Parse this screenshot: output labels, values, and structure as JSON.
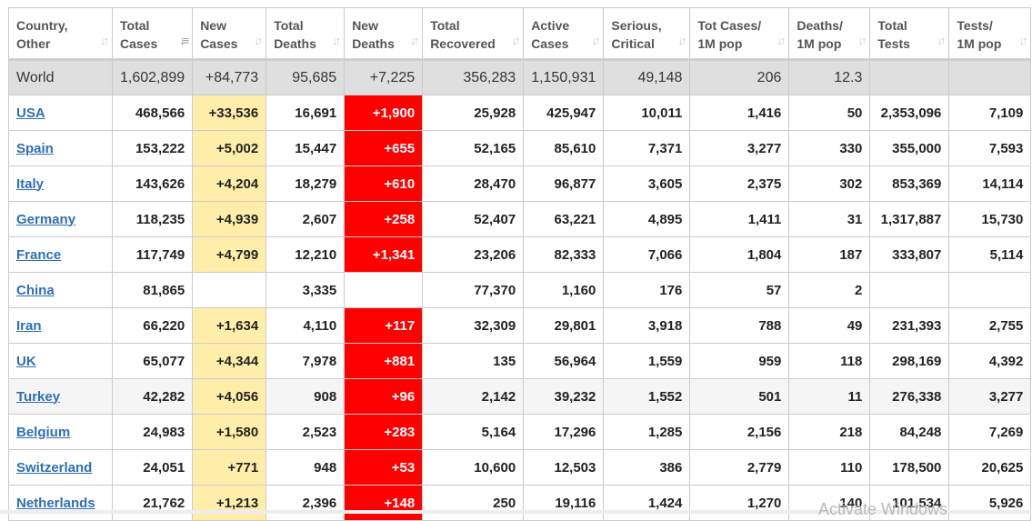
{
  "table": {
    "columns": [
      {
        "line1": "Country,",
        "line2": "Other",
        "sort_icon": "sort-icon",
        "active": false
      },
      {
        "line1": "Total",
        "line2": "Cases",
        "sort_icon": "sort-desc-icon",
        "active": true
      },
      {
        "line1": "New",
        "line2": "Cases",
        "sort_icon": "sort-icon",
        "active": false
      },
      {
        "line1": "Total",
        "line2": "Deaths",
        "sort_icon": "sort-icon",
        "active": false
      },
      {
        "line1": "New",
        "line2": "Deaths",
        "sort_icon": "sort-icon",
        "active": false
      },
      {
        "line1": "Total",
        "line2": "Recovered",
        "sort_icon": "sort-icon",
        "active": false
      },
      {
        "line1": "Active",
        "line2": "Cases",
        "sort_icon": "sort-icon",
        "active": false
      },
      {
        "line1": "Serious,",
        "line2": "Critical",
        "sort_icon": "sort-icon",
        "active": false
      },
      {
        "line1": "Tot Cases/",
        "line2": "1M pop",
        "sort_icon": "sort-icon",
        "active": false
      },
      {
        "line1": "Deaths/",
        "line2": "1M pop",
        "sort_icon": "sort-icon",
        "active": false
      },
      {
        "line1": "Total",
        "line2": "Tests",
        "sort_icon": "sort-icon",
        "active": false
      },
      {
        "line1": "Tests/",
        "line2": "1M pop",
        "sort_icon": "sort-icon",
        "active": false
      }
    ],
    "world": [
      "World",
      "1,602,899",
      "+84,773",
      "95,685",
      "+7,225",
      "356,283",
      "1,150,931",
      "49,148",
      "206",
      "12.3",
      "",
      ""
    ],
    "rows": [
      [
        "USA",
        "468,566",
        "+33,536",
        "16,691",
        "+1,900",
        "25,928",
        "425,947",
        "10,011",
        "1,416",
        "50",
        "2,353,096",
        "7,109"
      ],
      [
        "Spain",
        "153,222",
        "+5,002",
        "15,447",
        "+655",
        "52,165",
        "85,610",
        "7,371",
        "3,277",
        "330",
        "355,000",
        "7,593"
      ],
      [
        "Italy",
        "143,626",
        "+4,204",
        "18,279",
        "+610",
        "28,470",
        "96,877",
        "3,605",
        "2,375",
        "302",
        "853,369",
        "14,114"
      ],
      [
        "Germany",
        "118,235",
        "+4,939",
        "2,607",
        "+258",
        "52,407",
        "63,221",
        "4,895",
        "1,411",
        "31",
        "1,317,887",
        "15,730"
      ],
      [
        "France",
        "117,749",
        "+4,799",
        "12,210",
        "+1,341",
        "23,206",
        "82,333",
        "7,066",
        "1,804",
        "187",
        "333,807",
        "5,114"
      ],
      [
        "China",
        "81,865",
        "",
        "3,335",
        "",
        "77,370",
        "1,160",
        "176",
        "57",
        "2",
        "",
        ""
      ],
      [
        "Iran",
        "66,220",
        "+1,634",
        "4,110",
        "+117",
        "32,309",
        "29,801",
        "3,918",
        "788",
        "49",
        "231,393",
        "2,755"
      ],
      [
        "UK",
        "65,077",
        "+4,344",
        "7,978",
        "+881",
        "135",
        "56,964",
        "1,559",
        "959",
        "118",
        "298,169",
        "4,392"
      ],
      [
        "Turkey",
        "42,282",
        "+4,056",
        "908",
        "+96",
        "2,142",
        "39,232",
        "1,552",
        "501",
        "11",
        "276,338",
        "3,277"
      ],
      [
        "Belgium",
        "24,983",
        "+1,580",
        "2,523",
        "+283",
        "5,164",
        "17,296",
        "1,285",
        "2,156",
        "218",
        "84,248",
        "7,269"
      ],
      [
        "Switzerland",
        "24,051",
        "+771",
        "948",
        "+53",
        "10,600",
        "12,503",
        "386",
        "2,779",
        "110",
        "178,500",
        "20,625"
      ],
      [
        "Netherlands",
        "21,762",
        "+1,213",
        "2,396",
        "+148",
        "250",
        "19,116",
        "1,424",
        "1,270",
        "140",
        "101,534",
        "5,926"
      ]
    ],
    "highlighted_row": 8
  },
  "colors": {
    "new_cases_bg": "#ffeeaa",
    "new_deaths_bg": "#ff0000",
    "world_row_bg": "#dfdfdf",
    "link": "#2e6fb5"
  },
  "overlay": {
    "watermark": "Activate Windows"
  }
}
